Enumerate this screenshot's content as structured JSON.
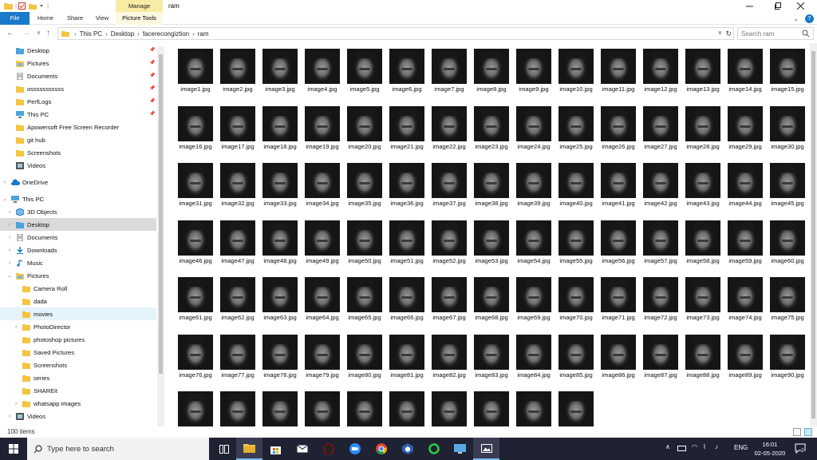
{
  "window": {
    "title": "ram",
    "manage_label": "Manage",
    "controls": [
      "minimize-icon",
      "maximize-icon",
      "close-icon"
    ]
  },
  "ribbon": {
    "tabs": [
      {
        "label": "File",
        "name": "tab-file"
      },
      {
        "label": "Home",
        "name": "tab-home"
      },
      {
        "label": "Share",
        "name": "tab-share"
      },
      {
        "label": "View",
        "name": "tab-view"
      },
      {
        "label": "Picture Tools",
        "name": "tab-picture-tools"
      }
    ],
    "help_glyph": "?"
  },
  "address": {
    "breadcrumbs": [
      "This PC",
      "Desktop",
      "facerecongiztion",
      "ram"
    ],
    "search_placeholder": "Search ram"
  },
  "navpane": {
    "items": [
      {
        "label": "Desktop",
        "icon": "folder-blue-icon",
        "pinned": true,
        "level": 1
      },
      {
        "label": "Pictures",
        "icon": "pictures-icon",
        "pinned": true,
        "level": 1
      },
      {
        "label": "Documents",
        "icon": "documents-icon",
        "pinned": true,
        "level": 1
      },
      {
        "label": "osssssssssss",
        "icon": "folder-icon",
        "pinned": true,
        "level": 1
      },
      {
        "label": "PerfLogs",
        "icon": "folder-icon",
        "pinned": true,
        "level": 1
      },
      {
        "label": "This PC",
        "icon": "pc-icon",
        "pinned": true,
        "level": 1
      },
      {
        "label": "Apowersoft Free Screen Recorder",
        "icon": "folder-icon",
        "pinned": false,
        "level": 1
      },
      {
        "label": "git hub",
        "icon": "folder-icon",
        "pinned": false,
        "level": 1
      },
      {
        "label": "Screenshots",
        "icon": "folder-icon",
        "pinned": false,
        "level": 1
      },
      {
        "label": "Videos",
        "icon": "videos-icon",
        "pinned": false,
        "level": 1
      },
      {
        "label": "OneDrive",
        "icon": "cloud-icon",
        "chevron": ">",
        "level": 0,
        "gap": true
      },
      {
        "label": "This PC",
        "icon": "pc-icon",
        "chevron": "v",
        "level": 0,
        "gap": true
      },
      {
        "label": "3D Objects",
        "icon": "cube-icon",
        "chevron": ">",
        "level": 1
      },
      {
        "label": "Desktop",
        "icon": "folder-blue-icon",
        "chevron": ">",
        "level": 1,
        "selected": true
      },
      {
        "label": "Documents",
        "icon": "documents-icon",
        "chevron": ">",
        "level": 1
      },
      {
        "label": "Downloads",
        "icon": "download-icon",
        "chevron": ">",
        "level": 1
      },
      {
        "label": "Music",
        "icon": "music-icon",
        "chevron": ">",
        "level": 1
      },
      {
        "label": "Pictures",
        "icon": "pictures-icon",
        "chevron": "v",
        "level": 1
      },
      {
        "label": "Camera Roll",
        "icon": "folder-icon",
        "level": 2
      },
      {
        "label": "dada",
        "icon": "folder-icon",
        "level": 2
      },
      {
        "label": "movies",
        "icon": "folder-icon",
        "level": 2,
        "highlight": true
      },
      {
        "label": "PhotoDirector",
        "icon": "folder-icon",
        "chevron": ">",
        "level": 2
      },
      {
        "label": "photoshop pictures",
        "icon": "folder-icon",
        "level": 2
      },
      {
        "label": "Saved Pictures",
        "icon": "folder-icon",
        "level": 2
      },
      {
        "label": "Screenshots",
        "icon": "folder-icon",
        "level": 2
      },
      {
        "label": "series",
        "icon": "folder-icon",
        "level": 2
      },
      {
        "label": "SHAREit",
        "icon": "folder-icon",
        "level": 2
      },
      {
        "label": "whatsapp images",
        "icon": "folder-icon",
        "chevron": ">",
        "level": 2
      },
      {
        "label": "Videos",
        "icon": "videos-icon",
        "chevron": ">",
        "level": 1
      }
    ]
  },
  "files": {
    "prefix": "image",
    "extension": ".jpg",
    "total": 100
  },
  "status": {
    "item_count": "100 items"
  },
  "taskbar": {
    "search_placeholder": "Type here to search",
    "apps": [
      "task-view-icon",
      "file-explorer-icon",
      "store-icon",
      "mail-icon",
      "game-icon",
      "zoom-icon",
      "chrome-icon",
      "virtualbox-icon",
      "circle-app-icon",
      "remote-desktop-icon",
      "photos-icon"
    ],
    "language": "ENG",
    "time": "16:01",
    "date": "02-05-2020",
    "notification_count": "2"
  },
  "colors": {
    "accent": "#1979ca",
    "manage_tab": "#f7eba6",
    "taskbar": "#1f2233",
    "folder": "#f4c542"
  }
}
